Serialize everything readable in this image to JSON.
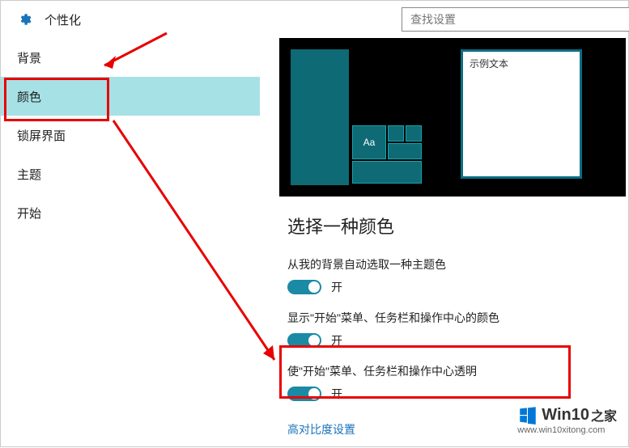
{
  "header": {
    "title": "个性化"
  },
  "search": {
    "placeholder": "查找设置"
  },
  "sidebar": {
    "items": [
      {
        "label": "背景"
      },
      {
        "label": "颜色"
      },
      {
        "label": "锁屏界面"
      },
      {
        "label": "主题"
      },
      {
        "label": "开始"
      }
    ],
    "selected_index": 1
  },
  "preview": {
    "window_title": "示例文本",
    "tile_text": "Aa"
  },
  "section_heading": "选择一种颜色",
  "settings": [
    {
      "label": "从我的背景自动选取一种主题色",
      "state": "开"
    },
    {
      "label": "显示\"开始\"菜单、任务栏和操作中心的颜色",
      "state": "开"
    },
    {
      "label": "使\"开始\"菜单、任务栏和操作中心透明",
      "state": "开"
    }
  ],
  "link": "高对比度设置",
  "watermark": {
    "brand": "Win10",
    "suffix": "之家",
    "url": "www.win10xitong.com"
  }
}
